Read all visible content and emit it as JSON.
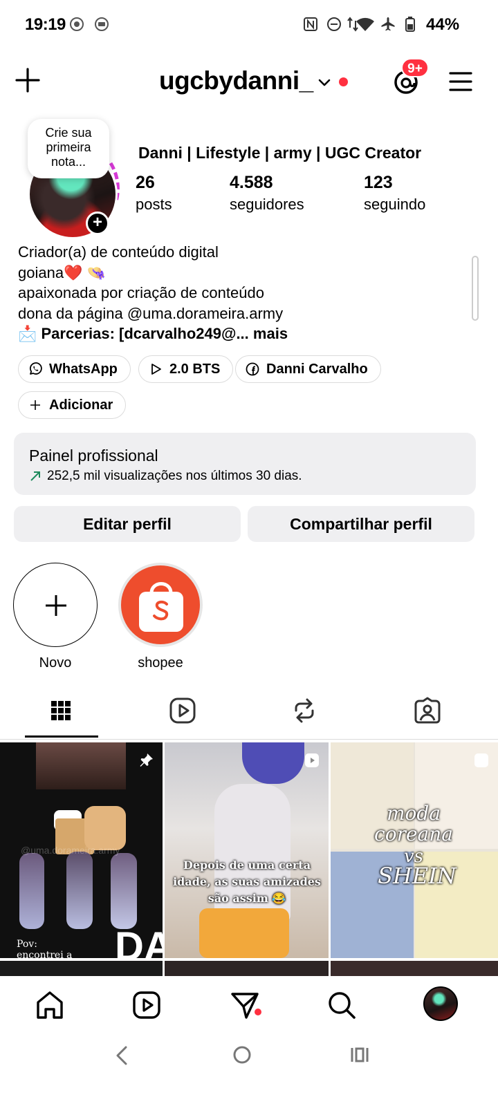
{
  "status_bar": {
    "time": "19:19",
    "battery": "44%"
  },
  "header": {
    "username": "ugcbydanni_",
    "notif_badge": "9+"
  },
  "profile": {
    "note_bubble": [
      "Crie sua",
      "primeira",
      "nota..."
    ],
    "display_name": "Danni | Lifestyle | army | UGC Creator",
    "stats": [
      {
        "value": "26",
        "label": "posts"
      },
      {
        "value": "4.588",
        "label": "seguidores"
      },
      {
        "value": "123",
        "label": "seguindo"
      }
    ],
    "bio": {
      "line1": "Criador(a) de conteúdo digital",
      "line2": "goiana❤️ 👒",
      "line3": "apaixonada por criação de conteúdo",
      "line4": "dona da página @uma.dorameira.army",
      "line5": "📩 Parcerias: [dcarvalho249@...",
      "more": "mais"
    }
  },
  "chips": {
    "whatsapp": "WhatsApp",
    "bts": "2.0 BTS",
    "facebook": "Danni Carvalho",
    "add": "Adicionar"
  },
  "dashboard": {
    "title": "Painel profissional",
    "subtitle": "252,5 mil visualizações nos últimos 30 dias."
  },
  "buttons": {
    "edit": "Editar perfil",
    "share": "Compartilhar perfil"
  },
  "highlights": [
    {
      "label": "Novo"
    },
    {
      "label": "shopee"
    }
  ],
  "posts": {
    "p1_caption": "Pov: encontrei a camiseta",
    "p1_watermark": "@uma.dorameira.army",
    "p2_caption": "Depois de uma certa idade, as suas amizades são assim 😂",
    "p3_caption_1": "moda",
    "p3_caption_2": "coreana",
    "p3_caption_3": "vs",
    "p3_caption_4": "SHEIN"
  },
  "colors": {
    "accent_red": "#ff3040",
    "panel_bg": "#efeff1",
    "story_ring": "#d63ad6"
  }
}
